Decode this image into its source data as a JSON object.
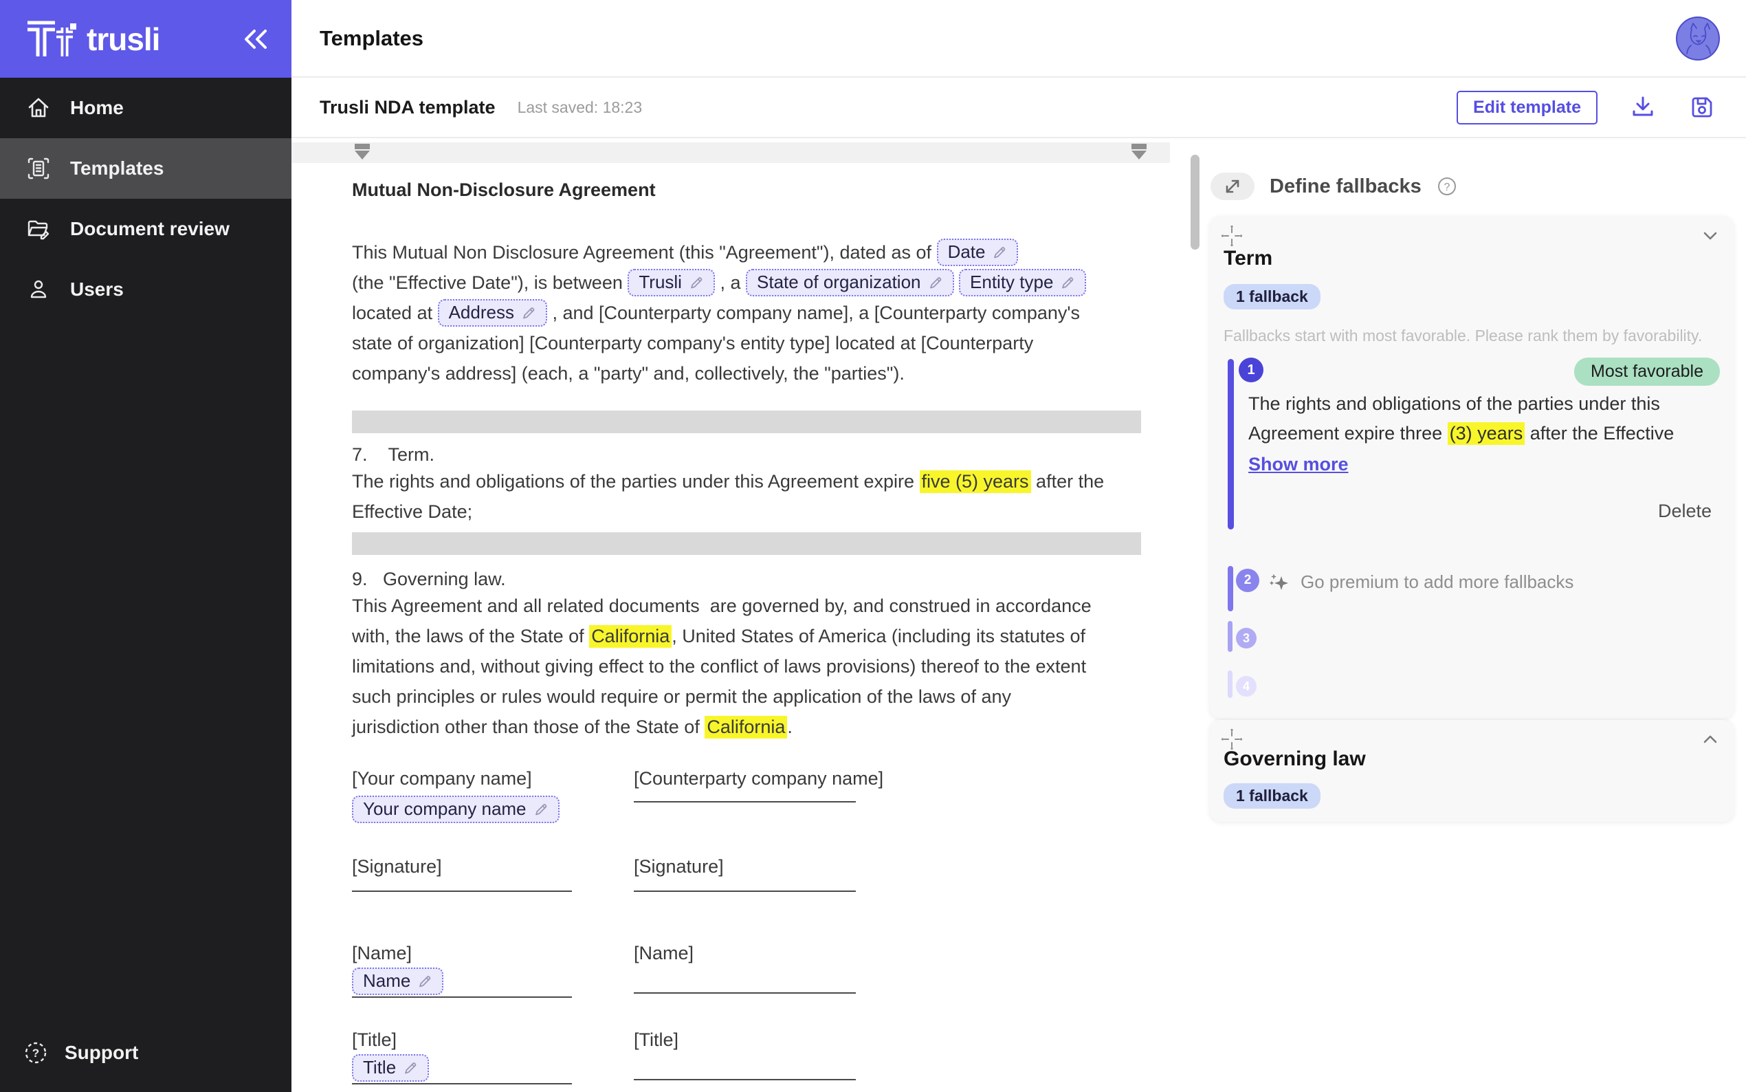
{
  "colors": {
    "brand": "#5e59e8",
    "accent": "#554ee2",
    "link": "#564fe0",
    "sidebarbg": "#1e1d1f",
    "sidebarsel": "#4b4a4c",
    "chipbg": "#ebeafc",
    "chipborder": "#7b74ee",
    "highlight": "#f8f62a",
    "graybar": "#d9d9d9",
    "pillblue": "#ccd8f8",
    "pillgreen": "#abe0c3",
    "rank1": "#4a43d8",
    "bar1": "#564fe0",
    "rank2": "#8a84ee",
    "bar2": "#7d76ec",
    "rank3": "#b0abf4",
    "bar3": "#a7a2f2",
    "rank4": "#e2e0fc",
    "bar4": "#dcdafb",
    "avatarbg": "#7b7ee3"
  },
  "sidebar": {
    "brand": "trusli",
    "items": [
      {
        "label": "Home"
      },
      {
        "label": "Templates"
      },
      {
        "label": "Document review"
      },
      {
        "label": "Users"
      }
    ],
    "support_label": "Support"
  },
  "header": {
    "title": "Templates"
  },
  "toolbar": {
    "doc_title": "Trusli NDA template",
    "last_saved": "Last saved: 18:23",
    "edit_button": "Edit template"
  },
  "document": {
    "title": "Mutual Non-Disclosure Agreement",
    "para1_lines": [
      [
        {
          "t": "text",
          "v": "This Mutual Non Disclosure Agreement (this \"Agreement\"), dated as of "
        },
        {
          "t": "chip",
          "v": "Date"
        }
      ],
      [
        {
          "t": "text",
          "v": "(the \"Effective Date\"), is between "
        },
        {
          "t": "chip",
          "v": "Trusli"
        },
        {
          "t": "text",
          "v": " , a "
        },
        {
          "t": "chip",
          "v": "State of organization"
        },
        {
          "t": "text",
          "v": " "
        },
        {
          "t": "chip",
          "v": "Entity type"
        }
      ],
      [
        {
          "t": "text",
          "v": "located at "
        },
        {
          "t": "chip",
          "v": "Address"
        },
        {
          "t": "text",
          "v": " , and [Counterparty company name], a [Counterparty company's"
        }
      ],
      [
        {
          "t": "text",
          "v": "state of organization] [Counterparty company's entity type] located at [Counterparty"
        }
      ],
      [
        {
          "t": "text",
          "v": "company's address] (each, a \"party\" and, collectively, the \"parties\")."
        }
      ]
    ],
    "section7_heading": "7.    Term.",
    "section7_lines": [
      [
        {
          "t": "text",
          "v": "The rights and obligations of the parties under this Agreement expire "
        },
        {
          "t": "hl",
          "v": "five (5) years"
        },
        {
          "t": "text",
          "v": " after the"
        }
      ],
      [
        {
          "t": "text",
          "v": "Effective Date;"
        }
      ]
    ],
    "section9_heading": "9.   Governing law.",
    "section9_lines": [
      [
        {
          "t": "text",
          "v": "This Agreement and all related documents  are governed by, and construed in accordance"
        }
      ],
      [
        {
          "t": "text",
          "v": "with, the laws of the State of "
        },
        {
          "t": "hl",
          "v": "California"
        },
        {
          "t": "text",
          "v": ", United States of America (including its statutes of"
        }
      ],
      [
        {
          "t": "text",
          "v": "limitations and, without giving effect to the conflict of laws provisions) thereof to the extent"
        }
      ],
      [
        {
          "t": "text",
          "v": "such principles or rules would require or permit the application of the laws of any"
        }
      ],
      [
        {
          "t": "text",
          "v": "jurisdiction other than those of the State of "
        },
        {
          "t": "hl",
          "v": "California"
        },
        {
          "t": "text",
          "v": "."
        }
      ]
    ],
    "signature": {
      "company_left": "[Your company name]",
      "company_right": "[Counterparty company name]",
      "company_chip": "Your company name",
      "signature_label": "[Signature]",
      "name_label": "[Name]",
      "name_chip": "Name",
      "title_label": "[Title]",
      "title_chip": "Title"
    }
  },
  "panel": {
    "title": "Define fallbacks",
    "term_card": {
      "heading": "Term",
      "fallback_count": "1 fallback",
      "helper": "Fallbacks start with most favorable. Please rank them by favorability.",
      "rank1": {
        "num": "1",
        "badge": "Most favorable",
        "lines": [
          [
            {
              "t": "text",
              "v": "The rights and obligations of the parties under this"
            }
          ],
          [
            {
              "t": "text",
              "v": "Agreement expire three "
            },
            {
              "t": "hl",
              "v": "(3) years"
            },
            {
              "t": "text",
              "v": " after the Effective"
            }
          ]
        ],
        "show_more": "Show more",
        "delete_label": "Delete"
      },
      "rank2": {
        "num": "2",
        "label": "Go premium to add more fallbacks"
      },
      "rank3": {
        "num": "3"
      },
      "rank4": {
        "num": "4"
      }
    },
    "law_card": {
      "heading": "Governing law",
      "fallback_count": "1 fallback"
    }
  }
}
